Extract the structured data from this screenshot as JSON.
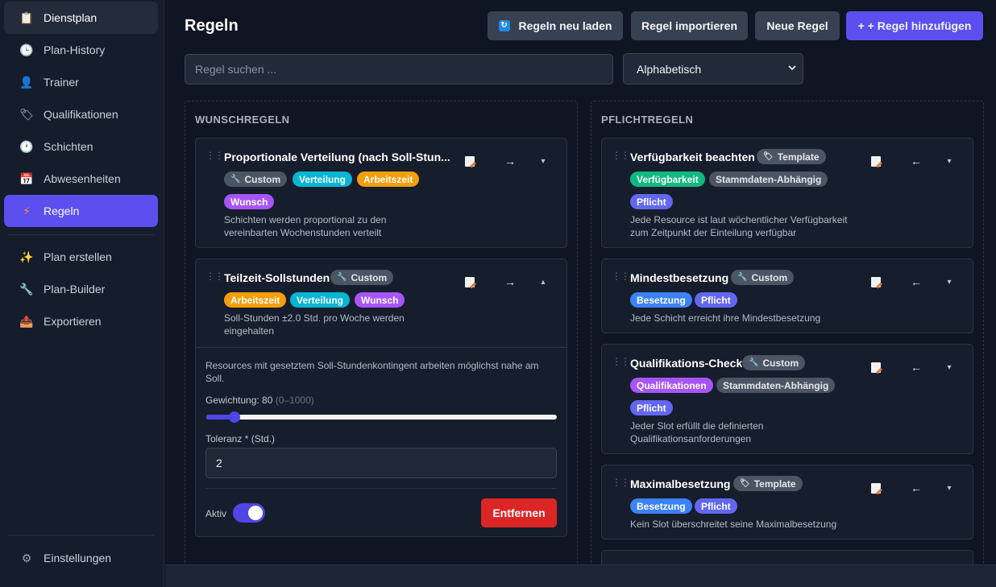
{
  "sidebar": {
    "items": [
      {
        "label": "Dienstplan",
        "icon": "clipboard-icon"
      },
      {
        "label": "Plan-History",
        "icon": "clock-icon"
      },
      {
        "label": "Trainer",
        "icon": "person-icon"
      },
      {
        "label": "Qualifikationen",
        "icon": "tag-icon"
      },
      {
        "label": "Schichten",
        "icon": "clock-icon"
      },
      {
        "label": "Abwesenheiten",
        "icon": "calendar-icon"
      },
      {
        "label": "Regeln",
        "icon": "lightning-icon"
      },
      {
        "label": "Plan erstellen",
        "icon": "sparkles-icon"
      },
      {
        "label": "Plan-Builder",
        "icon": "wrench-icon"
      },
      {
        "label": "Exportieren",
        "icon": "export-icon"
      }
    ],
    "settings": {
      "label": "Einstellungen",
      "icon": "gear-icon"
    }
  },
  "header": {
    "title": "Regeln",
    "buttons": {
      "reload": "Regeln neu laden",
      "import": "Regel importieren",
      "new": "Neue Regel",
      "add": "+ + Regel hinzufügen"
    }
  },
  "search": {
    "placeholder": "Regel suchen ...",
    "value": ""
  },
  "sort": {
    "selected": "Alphabetisch"
  },
  "wunsch": {
    "heading": "WUNSCHREGELN",
    "cards": [
      {
        "title": "Proportionale Verteilung (nach Soll-Stun...",
        "badges": [
          "Custom",
          "Verteilung",
          "Arbeitszeit",
          "Wunsch"
        ],
        "description": "Schichten werden proportional zu den vereinbarten Wochenstunden verteilt",
        "arrow": "→",
        "chevron": "▾"
      },
      {
        "title": "Teilzeit-Sollstunden",
        "badges": [
          "Custom",
          "Arbeitszeit",
          "Verteilung",
          "Wunsch"
        ],
        "description": "Soll-Stunden ±2.0 Std. pro Woche werden eingehalten",
        "arrow": "→",
        "chevron": "▴",
        "expanded": {
          "text": "Resources mit gesetztem Soll-Stundenkontingent arbeiten möglichst nahe am Soll.",
          "weight_label": "Gewichtung: 80",
          "weight_range": "(0–1000)",
          "weight_value": 80,
          "weight_max": 1000,
          "tolerance_label": "Toleranz * (Std.)",
          "tolerance_value": "2",
          "active_label": "Aktiv",
          "active": true,
          "remove_label": "Entfernen"
        }
      }
    ]
  },
  "pflicht": {
    "heading": "PFLICHTREGELN",
    "cards": [
      {
        "title": "Verfügbarkeit beachten",
        "badges": [
          "Template",
          "Verfügbarkeit",
          "Stammdaten-Abhängig",
          "Pflicht"
        ],
        "description": "Jede Resource ist laut wöchentlicher Verfügbarkeit zum Zeitpunkt der Einteilung verfügbar",
        "arrow": "←",
        "chevron": "▾"
      },
      {
        "title": "Mindestbesetzung",
        "badges": [
          "Custom",
          "Besetzung",
          "Pflicht"
        ],
        "description": "Jede Schicht erreicht ihre Mindestbesetzung",
        "arrow": "←",
        "chevron": "▾"
      },
      {
        "title": "Qualifikations-Check",
        "badges": [
          "Custom",
          "Qualifikationen",
          "Stammdaten-Abhängig",
          "Pflicht"
        ],
        "description": "Jeder Slot erfüllt die definierten Qualifikationsanforderungen",
        "arrow": "←",
        "chevron": "▾"
      },
      {
        "title": "Maximalbesetzung",
        "badges": [
          "Template",
          "Besetzung",
          "Pflicht"
        ],
        "description": "Kein Slot überschreitet seine Maximalbesetzung",
        "arrow": "←",
        "chevron": "▾"
      }
    ]
  },
  "colors": {
    "accent": "#5b4ff0",
    "danger": "#dc2626",
    "badge_gray": "#4b5563",
    "badge_cyan": "#06b6d4",
    "badge_orange": "#f59e0b",
    "badge_purple": "#a855f7",
    "badge_green": "#10b981",
    "badge_blue": "#3b82f6",
    "badge_indigo": "#6366f1"
  }
}
